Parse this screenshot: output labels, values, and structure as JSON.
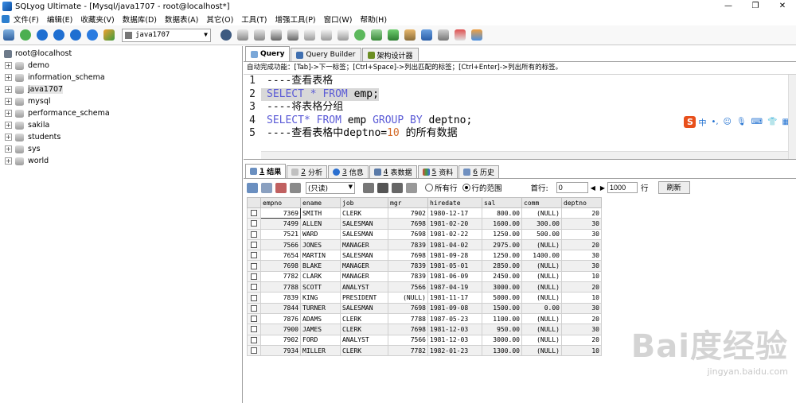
{
  "window": {
    "title": "SQLyog Ultimate - [Mysql/java1707 - root@localhost*]",
    "controls": [
      "—",
      "❐",
      "✕"
    ]
  },
  "menu": [
    "文件(F)",
    "编辑(E)",
    "收藏夹(V)",
    "数据库(D)",
    "数据表(A)",
    "其它(O)",
    "工具(T)",
    "增强工具(P)",
    "窗口(W)",
    "帮助(H)"
  ],
  "toolbar": {
    "db_select": "java1707"
  },
  "sidebar": {
    "root": "root@localhost",
    "databases": [
      "demo",
      "information_schema",
      "java1707",
      "mysql",
      "performance_schema",
      "sakila",
      "students",
      "sys",
      "world"
    ],
    "selected": "java1707"
  },
  "query_tabs": [
    {
      "label": "Query",
      "active": true
    },
    {
      "label": "Query Builder",
      "active": false
    },
    {
      "label": "架构设计器",
      "active": false
    }
  ],
  "hint": "自动完成功能：[Tab]->下一标签；[Ctrl+Space]->列出匹配的标签；[Ctrl+Enter]->列出所有的标签。",
  "editor": {
    "lines": [
      {
        "n": "1",
        "text": "----查看表格"
      },
      {
        "n": "2",
        "text": "SELECT * FROM emp;"
      },
      {
        "n": "3",
        "text": "----将表格分组"
      },
      {
        "n": "4",
        "text": "SELECT* FROM emp GROUP BY deptno;"
      },
      {
        "n": "5",
        "text": "----查看表格中deptno=10 的所有数据"
      }
    ]
  },
  "ime": {
    "logo": "S",
    "lang": "中"
  },
  "result_tabs": [
    {
      "num": "1",
      "label": "结果",
      "active": true
    },
    {
      "num": "2",
      "label": "分析",
      "active": false
    },
    {
      "num": "3",
      "label": "信息",
      "active": false
    },
    {
      "num": "4",
      "label": "表数据",
      "active": false
    },
    {
      "num": "5",
      "label": "资料",
      "active": false
    },
    {
      "num": "6",
      "label": "历史",
      "active": false
    }
  ],
  "result_toolbar": {
    "mode": "(只读)",
    "all_rows": "所有行",
    "range_rows": "行的范围",
    "first_row_label": "首行:",
    "first_row": "0",
    "row_count": "1000",
    "rows_label": "行",
    "refresh": "刷新"
  },
  "grid": {
    "columns": [
      "empno",
      "ename",
      "job",
      "mgr",
      "hiredate",
      "sal",
      "comm",
      "deptno"
    ],
    "rows": [
      [
        "7369",
        "SMITH",
        "CLERK",
        "7902",
        "1980-12-17",
        "800.00",
        "(NULL)",
        "20"
      ],
      [
        "7499",
        "ALLEN",
        "SALESMAN",
        "7698",
        "1981-02-20",
        "1600.00",
        "300.00",
        "30"
      ],
      [
        "7521",
        "WARD",
        "SALESMAN",
        "7698",
        "1981-02-22",
        "1250.00",
        "500.00",
        "30"
      ],
      [
        "7566",
        "JONES",
        "MANAGER",
        "7839",
        "1981-04-02",
        "2975.00",
        "(NULL)",
        "20"
      ],
      [
        "7654",
        "MARTIN",
        "SALESMAN",
        "7698",
        "1981-09-28",
        "1250.00",
        "1400.00",
        "30"
      ],
      [
        "7698",
        "BLAKE",
        "MANAGER",
        "7839",
        "1981-05-01",
        "2850.00",
        "(NULL)",
        "30"
      ],
      [
        "7782",
        "CLARK",
        "MANAGER",
        "7839",
        "1981-06-09",
        "2450.00",
        "(NULL)",
        "10"
      ],
      [
        "7788",
        "SCOTT",
        "ANALYST",
        "7566",
        "1987-04-19",
        "3000.00",
        "(NULL)",
        "20"
      ],
      [
        "7839",
        "KING",
        "PRESIDENT",
        "(NULL)",
        "1981-11-17",
        "5000.00",
        "(NULL)",
        "10"
      ],
      [
        "7844",
        "TURNER",
        "SALESMAN",
        "7698",
        "1981-09-08",
        "1500.00",
        "0.00",
        "30"
      ],
      [
        "7876",
        "ADAMS",
        "CLERK",
        "7788",
        "1987-05-23",
        "1100.00",
        "(NULL)",
        "20"
      ],
      [
        "7900",
        "JAMES",
        "CLERK",
        "7698",
        "1981-12-03",
        "950.00",
        "(NULL)",
        "30"
      ],
      [
        "7902",
        "FORD",
        "ANALYST",
        "7566",
        "1981-12-03",
        "3000.00",
        "(NULL)",
        "20"
      ],
      [
        "7934",
        "MILLER",
        "CLERK",
        "7782",
        "1982-01-23",
        "1300.00",
        "(NULL)",
        "10"
      ]
    ]
  },
  "watermark": {
    "logo": "Bai度经验",
    "url": "jingyan.baidu.com"
  }
}
